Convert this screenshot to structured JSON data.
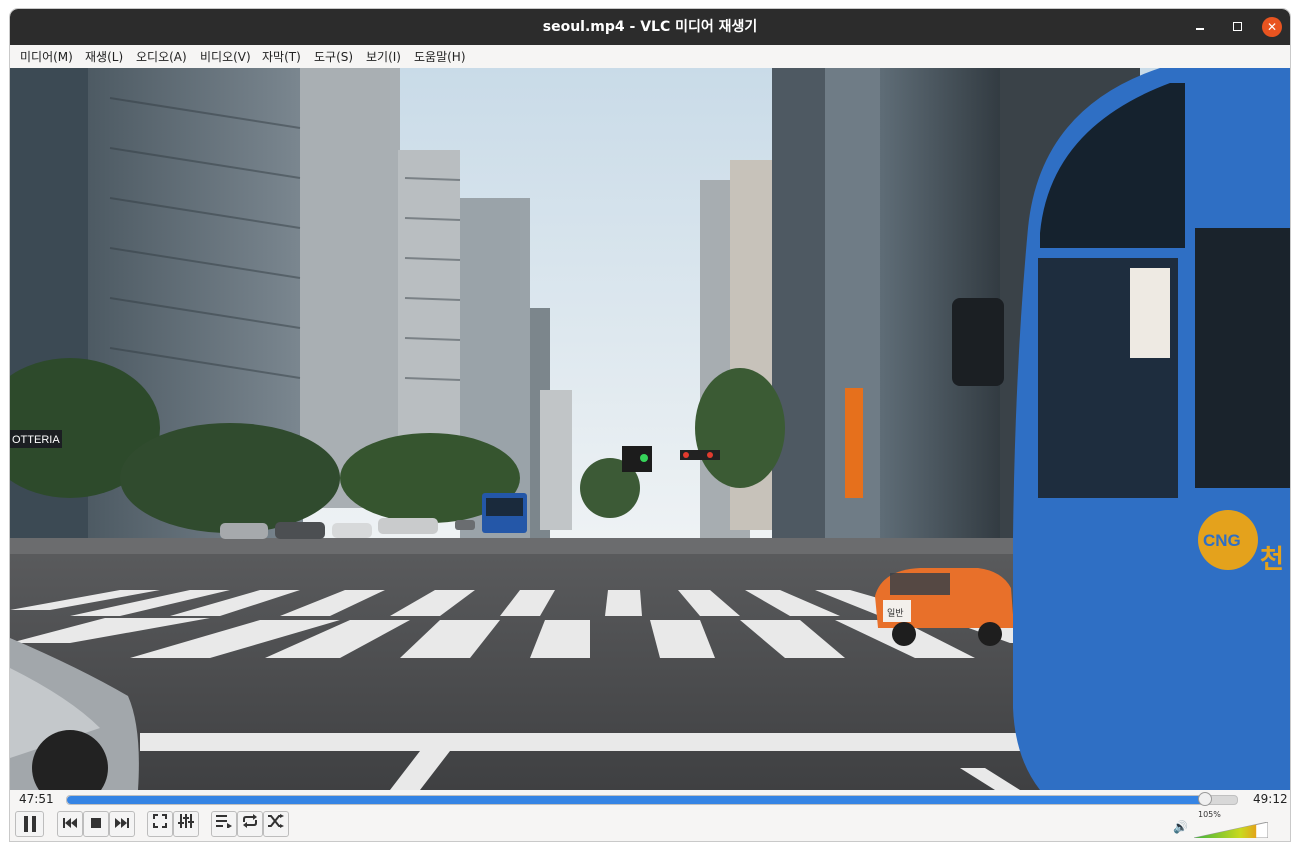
{
  "window": {
    "title": "seoul.mp4 - VLC 미디어 재생기"
  },
  "menu": [
    "미디어(M)",
    "재생(L)",
    "오디오(A)",
    "비디오(V)",
    "자막(T)",
    "도구(S)",
    "보기(I)",
    "도움말(H)"
  ],
  "video": {
    "signs": {
      "lotteria": "OTTERIA",
      "cng": "CNG",
      "bus_hangul": "천",
      "taxi_side": "일반"
    }
  },
  "playback": {
    "elapsed": "47:51",
    "total": "49:12",
    "progress": 0.973
  },
  "volume": {
    "label": "105%",
    "level": 1.05
  },
  "icons": {
    "pause": "pause-icon",
    "prev": "skip-back-icon",
    "stop": "stop-icon",
    "next": "skip-forward-icon",
    "fullscreen": "fullscreen-icon",
    "extended": "equalizer-icon",
    "playlist": "playlist-icon",
    "loop": "loop-icon",
    "shuffle": "shuffle-icon",
    "speaker": "speaker-icon"
  },
  "colors": {
    "accent": "#3584e4",
    "close": "#e95420",
    "bus": "#2f6fc4",
    "taxi": "#e8702a"
  }
}
